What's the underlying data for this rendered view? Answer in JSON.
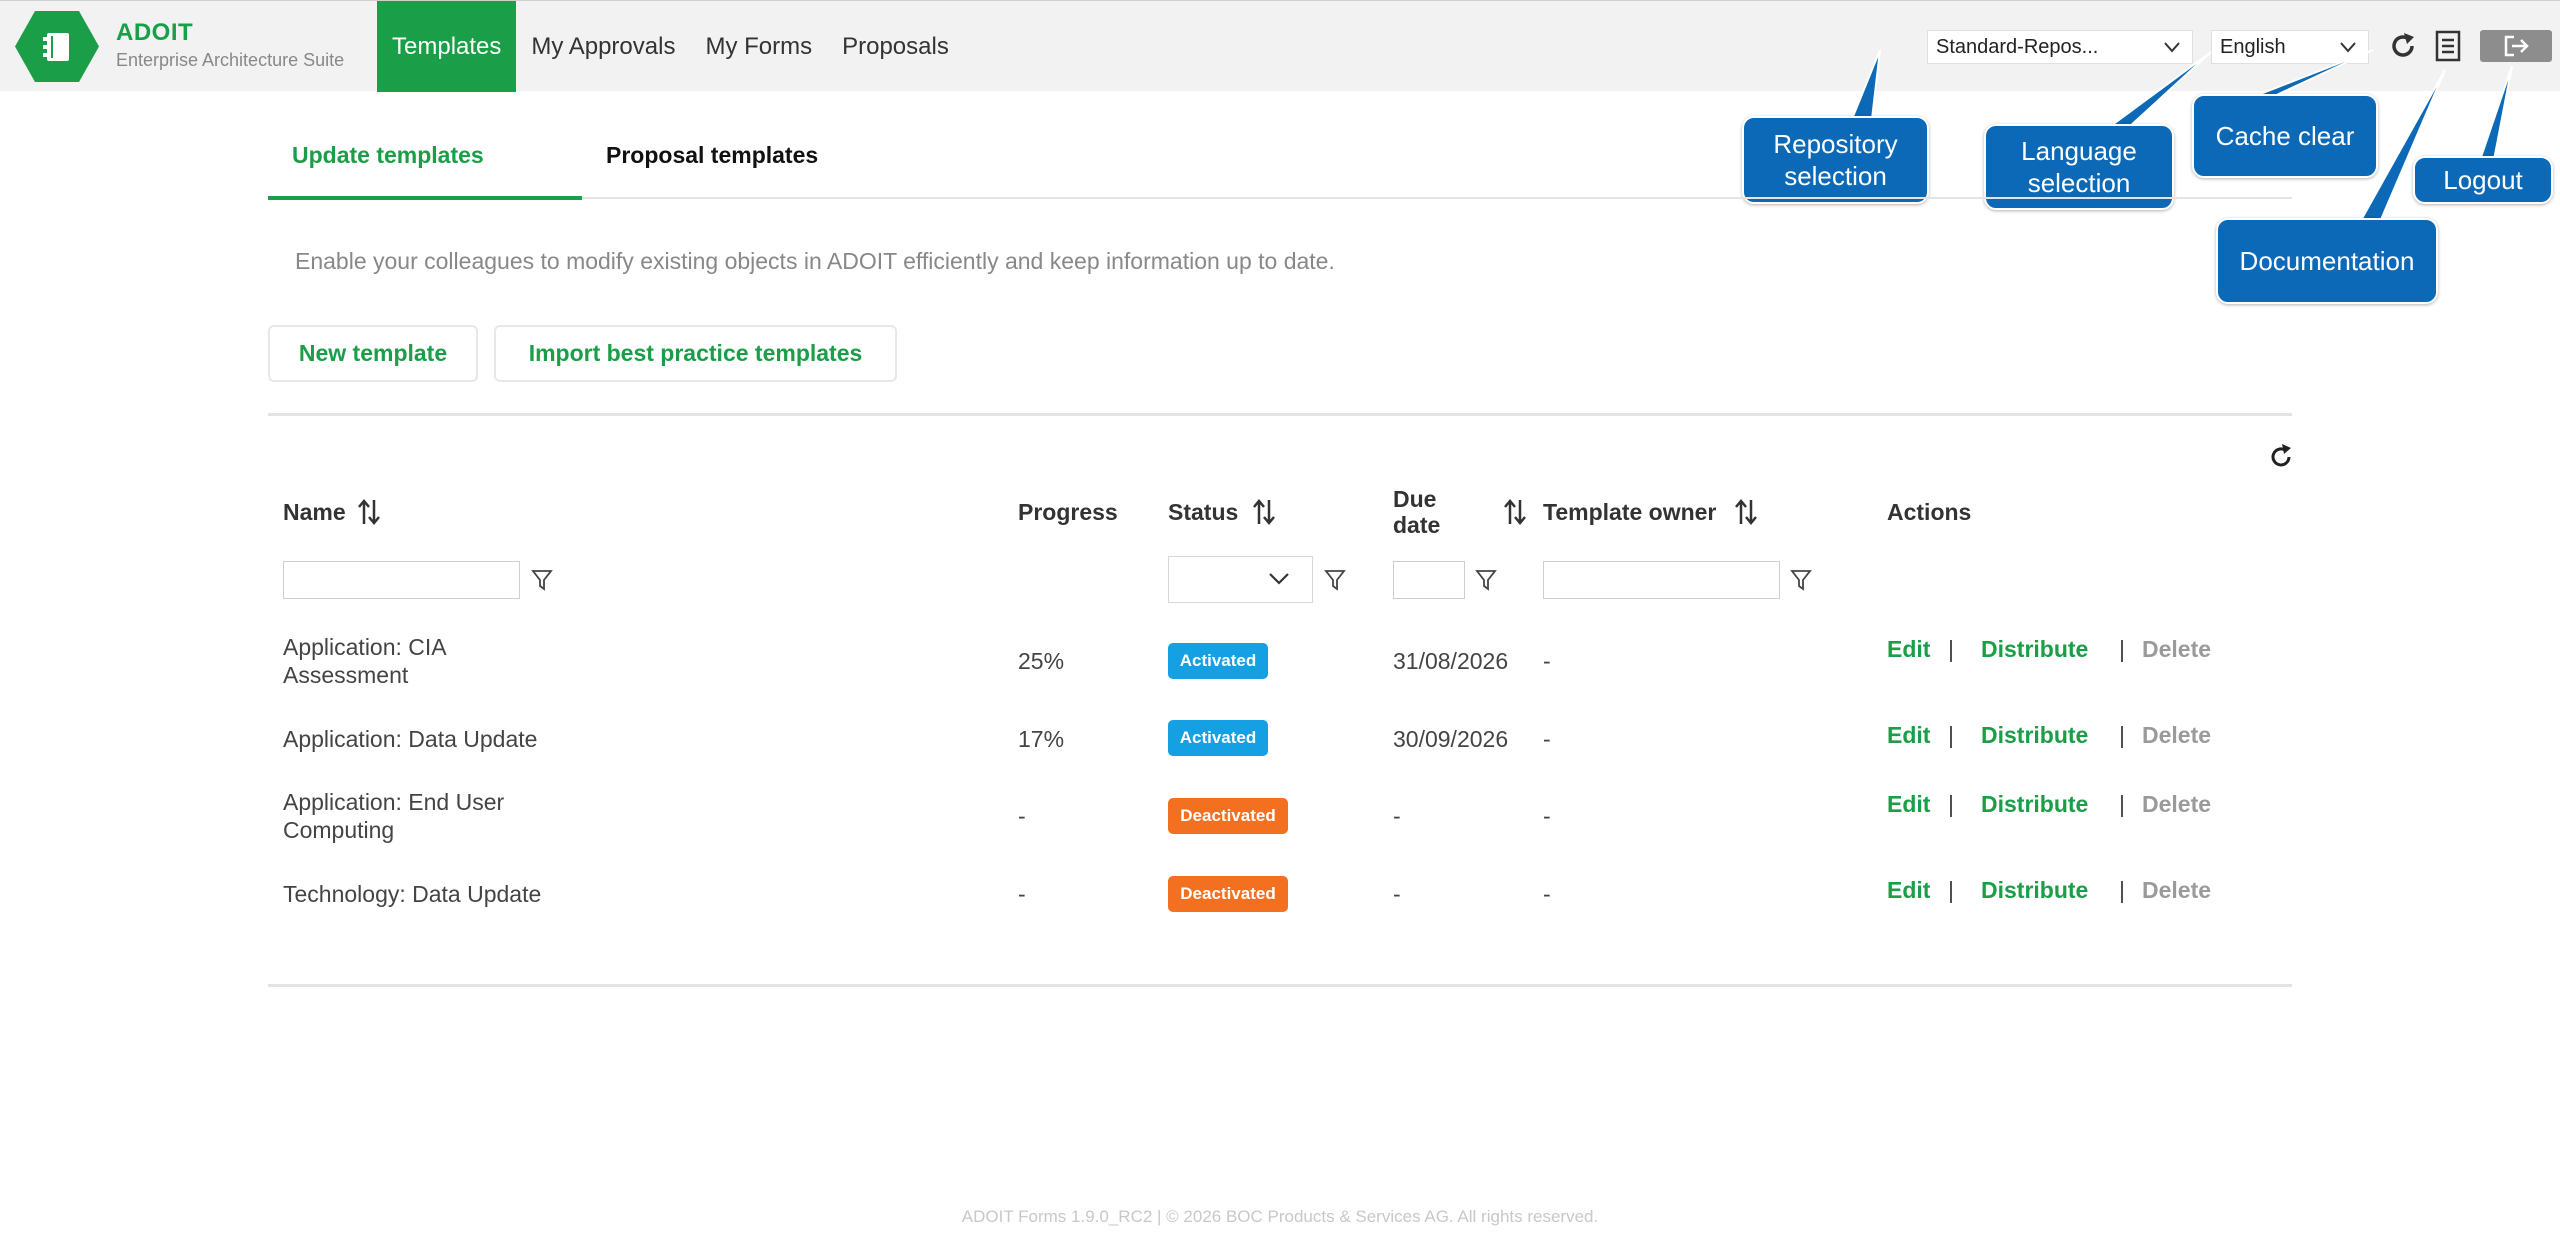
{
  "header": {
    "brand_title": "ADOIT",
    "brand_subtitle": "Enterprise Architecture Suite",
    "nav": [
      {
        "label": "Templates",
        "active": true
      },
      {
        "label": "My Approvals",
        "active": false
      },
      {
        "label": "My Forms",
        "active": false
      },
      {
        "label": "Proposals",
        "active": false
      }
    ],
    "repository_value": "Standard-Repos...",
    "language_value": "English",
    "accent_color": "#1a9e47"
  },
  "callouts": {
    "repository": "Repository selection",
    "language": "Language selection",
    "cache": "Cache clear",
    "documentation": "Documentation",
    "logout": "Logout"
  },
  "tabs": [
    {
      "label": "Update templates",
      "active": true
    },
    {
      "label": "Proposal templates",
      "active": false
    }
  ],
  "description": "Enable your colleagues to modify existing objects in ADOIT efficiently and keep information up to date.",
  "buttons": {
    "new_template": "New template",
    "import_templates": "Import best practice templates"
  },
  "table": {
    "headers": {
      "name": "Name",
      "progress": "Progress",
      "status": "Status",
      "due_date": "Due date",
      "owner": "Template owner",
      "actions": "Actions"
    },
    "action_labels": {
      "edit": "Edit",
      "distribute": "Distribute",
      "delete": "Delete",
      "separator": "|"
    },
    "rows": [
      {
        "name": "Application: CIA Assessment",
        "progress": "25%",
        "status": "Activated",
        "due": "31/08/2026",
        "owner": "-"
      },
      {
        "name": "Application: Data Update",
        "progress": "17%",
        "status": "Activated",
        "due": "30/09/2026",
        "owner": "-"
      },
      {
        "name": "Application: End User Computing",
        "progress": "-",
        "status": "Deactivated",
        "due": "-",
        "owner": "-"
      },
      {
        "name": "Technology: Data Update",
        "progress": "-",
        "status": "Deactivated",
        "due": "-",
        "owner": "-"
      }
    ]
  },
  "status_colors": {
    "Activated": "#14a0e3",
    "Deactivated": "#f37021"
  },
  "footer": "ADOIT Forms 1.9.0_RC2 | © 2026 BOC Products & Services AG. All rights reserved."
}
